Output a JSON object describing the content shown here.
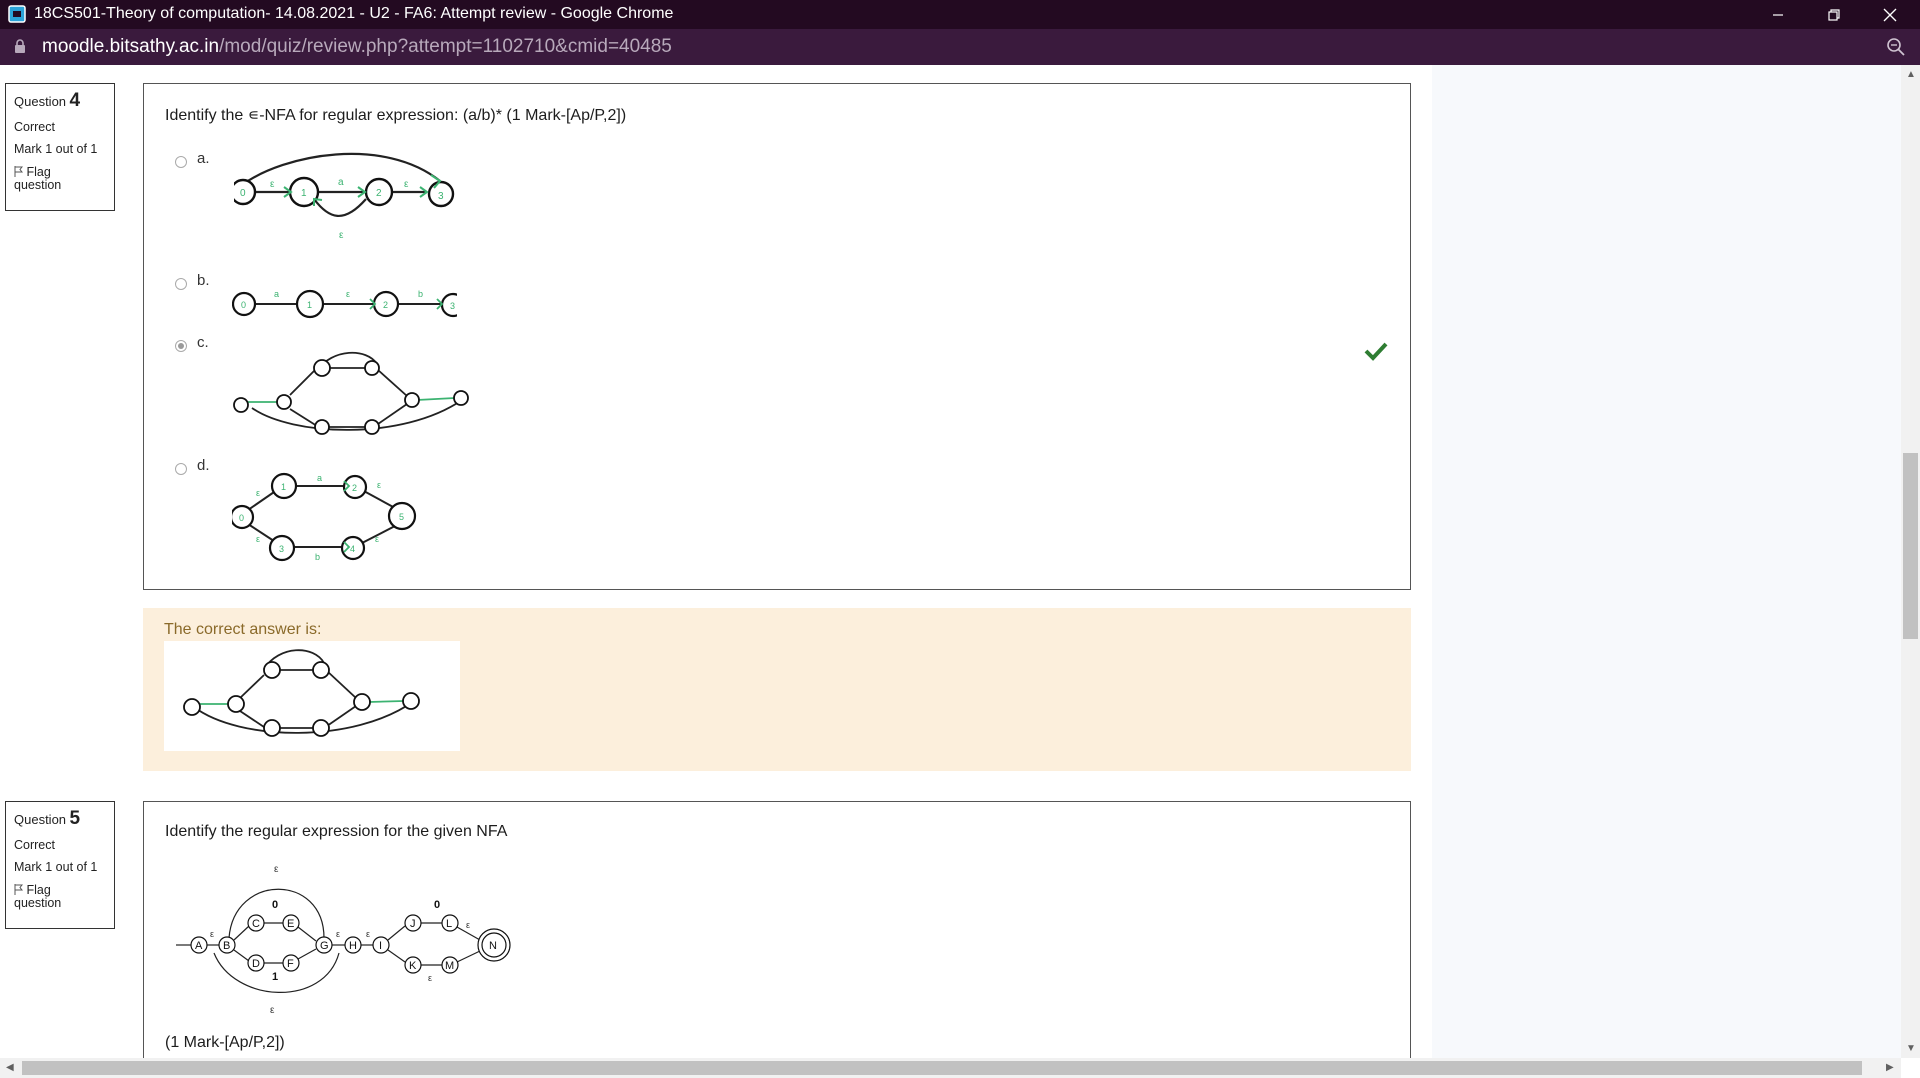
{
  "window": {
    "title": "18CS501-Theory of computation- 14.08.2021 - U2 - FA6: Attempt review - Google Chrome"
  },
  "address_bar": {
    "host": "moodle.bitsathy.ac.in",
    "path": "/mod/quiz/review.php?attempt=1102710&cmid=40485"
  },
  "questions": [
    {
      "label": "Question",
      "number": "4",
      "status": "Correct",
      "mark": "Mark 1 out of 1",
      "flag_line1": "Flag",
      "flag_line2": "question",
      "text": "Identify the ∊-NFA for regular expression: (a/b)* (1 Mark-[Ap/P,2])",
      "options": [
        {
          "letter": "a.",
          "selected": false
        },
        {
          "letter": "b.",
          "selected": false
        },
        {
          "letter": "c.",
          "selected": true
        },
        {
          "letter": "d.",
          "selected": false
        }
      ],
      "feedback": "The correct answer is:"
    },
    {
      "label": "Question",
      "number": "5",
      "status": "Correct",
      "mark": "Mark 1 out of 1",
      "flag_line1": "Flag",
      "flag_line2": "question",
      "text": "Identify the regular expression for the given NFA",
      "footer": "(1 Mark-[Ap/P,2])"
    }
  ],
  "diagrams": {
    "q4a": {
      "states": [
        "0",
        "1",
        "2",
        "3"
      ],
      "labels": [
        "ε",
        "a",
        "ε",
        "ε"
      ]
    },
    "q4b": {
      "states": [
        "0",
        "1",
        "2",
        "3"
      ],
      "labels": [
        "a",
        "ε",
        "b"
      ]
    },
    "q4d": {
      "states": [
        "0",
        "1",
        "2",
        "3",
        "4",
        "5"
      ],
      "labels": [
        "ε",
        "a",
        "ε",
        "ε",
        "b",
        "ε"
      ]
    },
    "q5": {
      "states": [
        "A",
        "B",
        "C",
        "D",
        "E",
        "F",
        "G",
        "H",
        "I",
        "J",
        "K",
        "L",
        "M",
        "N"
      ],
      "labels": {
        "eps": "ε",
        "zero": "0",
        "one": "1"
      }
    }
  },
  "colors": {
    "titlebar": "#230a21",
    "addressbar": "#3a1a3d",
    "feedback_bg": "#fcefdc",
    "correct_check": "#2e7d32",
    "nfa_green": "#3cb371"
  }
}
